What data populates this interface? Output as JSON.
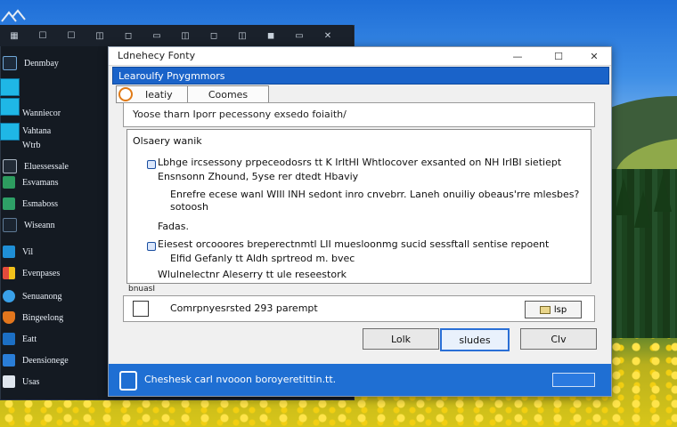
{
  "back_window": {
    "toolbar_items": [
      "▦",
      "☐",
      "☐",
      "◫",
      "◻",
      "▭",
      "◫",
      "◻",
      "◫",
      "◼",
      "▭",
      "✕"
    ]
  },
  "sidebar": {
    "items": [
      {
        "label": "Denmbay",
        "icon": "app-icon"
      },
      {
        "label": "",
        "icon": "cyan-block"
      },
      {
        "label": "Wanniecor",
        "icon": "cyan-block"
      },
      {
        "label": "Vahtana",
        "icon": "cyan-block"
      },
      {
        "label": "Wtrb",
        "icon": "cyan-block"
      },
      {
        "label": "Eluessessale",
        "icon": "folder-icon"
      },
      {
        "label": "Esvamans",
        "icon": "folder-icon"
      },
      {
        "label": "Esmaboss",
        "icon": "app-icon"
      },
      {
        "label": "Wiseann",
        "icon": "drive-icon"
      },
      {
        "label": "Vil",
        "icon": "network-icon"
      },
      {
        "label": "Evenpases",
        "icon": "color-icon"
      },
      {
        "label": "Senuanong",
        "icon": "cloud-icon"
      },
      {
        "label": "Bingeelong",
        "icon": "shield-icon"
      },
      {
        "label": "Eatt",
        "icon": "monitor-icon"
      },
      {
        "label": "Deensionege",
        "icon": "folder-icon"
      },
      {
        "label": "Usas",
        "icon": "list-icon"
      }
    ]
  },
  "dialog": {
    "title": "Ldnehecy Fonty",
    "window_buttons": {
      "minimize": "—",
      "maximize": "☐",
      "close": "✕"
    },
    "blue_header": "Learoulfy Pnygmmors",
    "tabs": [
      {
        "label": "Ieatiy"
      },
      {
        "label": "Coomes"
      }
    ],
    "description": "Yoose tharn Iporr pecessony exsedo foiaith/",
    "overview": {
      "title": "Olsaery wanik",
      "lines": [
        "Lbhge ircsessony prpeceodosrs tt  K  IrItHI Whtlocover exsanted on NH IrIBI sietiept",
        "Ensnsonn Zhound, 5yse rer dtedt Hbaviy",
        "Enrefre ecese wanl WIIl INH sedont inro cnvebrr.  Laneh onuiliy obeaus'rre mlesbes?",
        "sotoosh",
        "Fadas.",
        "Eiesest orcooores breperectnmtl  LII muesloonmg  sucid sessftall sentise repoent",
        "Elfid  Gefanly tt Aldh  sprtreod m. bvec",
        "Wlulnelectnr Aleserry tt ule reseestork"
      ]
    },
    "small_label": "bnuasI",
    "checkbox_text": "Comrpnyesrsted 293 parempt",
    "mini_button": "lsp",
    "buttons": {
      "left": "Lolk",
      "middle": "sludes",
      "right": "Clv"
    },
    "footer": {
      "text": "Cheshesk carl nvooon boroyeretittin.tt."
    }
  }
}
